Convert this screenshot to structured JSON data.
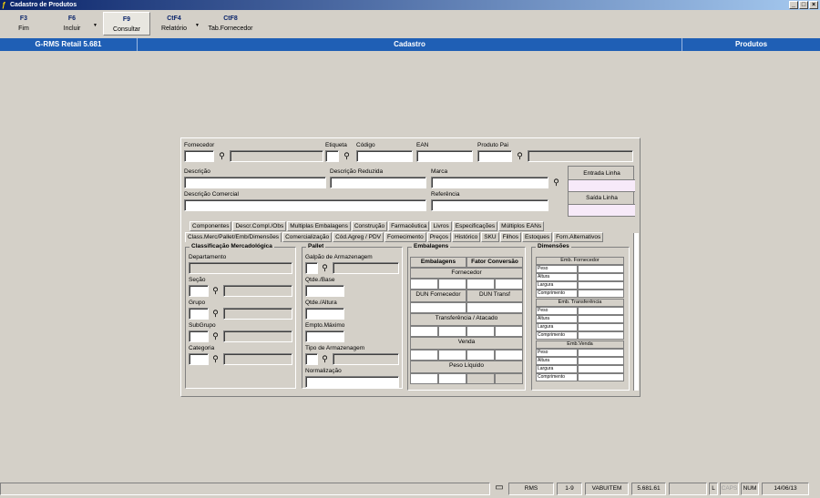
{
  "window": {
    "title": "Cadastro de Produtos"
  },
  "toolbar": [
    {
      "key": "F3",
      "label": "Fim"
    },
    {
      "key": "F6",
      "label": "Incluir"
    },
    {
      "key": "F9",
      "label": "Consultar"
    },
    {
      "key": "CtF4",
      "label": "Relatório"
    },
    {
      "key": "CtF8",
      "label": "Tab.Fornecedor"
    }
  ],
  "header": {
    "app": "G-RMS Retail 5.681",
    "section": "Cadastro",
    "module": "Produtos"
  },
  "form": {
    "fornecedor": "Fornecedor",
    "etiqueta": "Etiqueta",
    "codigo": "Código",
    "ean": "EAN",
    "produto_pai": "Produto Pai",
    "descricao": "Descrição",
    "descricao_reduzida": "Descrição Reduzida",
    "marca": "Marca",
    "descricao_comercial": "Descrição Comercial",
    "referencia": "Referência",
    "entrada_linha": "Entrada Linha",
    "saida_linha": "Saída Linha"
  },
  "tabs_row1": [
    "Componentes",
    "Descr.Compl./Obs",
    "Multiplas Embalagens",
    "Construção",
    "Farmacêutica",
    "Livros",
    "Especificações",
    "Múltiplos EANs"
  ],
  "tabs_row2": [
    "Class.Merc/Pallet/Emb/Dimensões",
    "Comercialização",
    "Cód.Agreg / PDV",
    "Fornecimento",
    "Preços",
    "Histórico",
    "SKU",
    "Filhos",
    "Estoques",
    "Forn.Alternativos"
  ],
  "classificacao": {
    "title": "Classificação Mercadológica",
    "departamento": "Departamento",
    "secao": "Seção",
    "grupo": "Grupo",
    "subgrupo": "SubGrupo",
    "categoria": "Categoria"
  },
  "pallet": {
    "title": "Pallet",
    "galpao": "Galpão de Armazenagem",
    "qtde_base": "Qtde./Base",
    "qtde_altura": "Qtde./Altura",
    "empto_maximo": "Empto.Máximo",
    "tipo_armazenagem": "Tipo de Armazenagem",
    "normalizacao": "Normalização"
  },
  "embalagens": {
    "title": "Embalagens",
    "col1": "Embalagens",
    "col2": "Fator Conversão",
    "fornecedor": "Fornecedor",
    "dun_fornecedor": "DUN Fornecedor",
    "dun_transf": "DUN Transf",
    "transferencia": "Transferência / Atacado",
    "venda": "Venda",
    "peso_liquido": "Peso Líquido"
  },
  "dimensoes": {
    "title": "Dimensões",
    "groups": [
      "Emb. Fornecedor",
      "Emb. Transferência",
      "Emb.Venda"
    ],
    "rows": [
      "Peso",
      "Altura",
      "Largura",
      "Comprimento"
    ]
  },
  "statusbar": {
    "system": "RMS",
    "page": "1-9",
    "user": "VABUITEM",
    "version": "5.681.61",
    "l": "L",
    "caps": "CAPS",
    "num": "NUM",
    "date": "14/06/13"
  }
}
